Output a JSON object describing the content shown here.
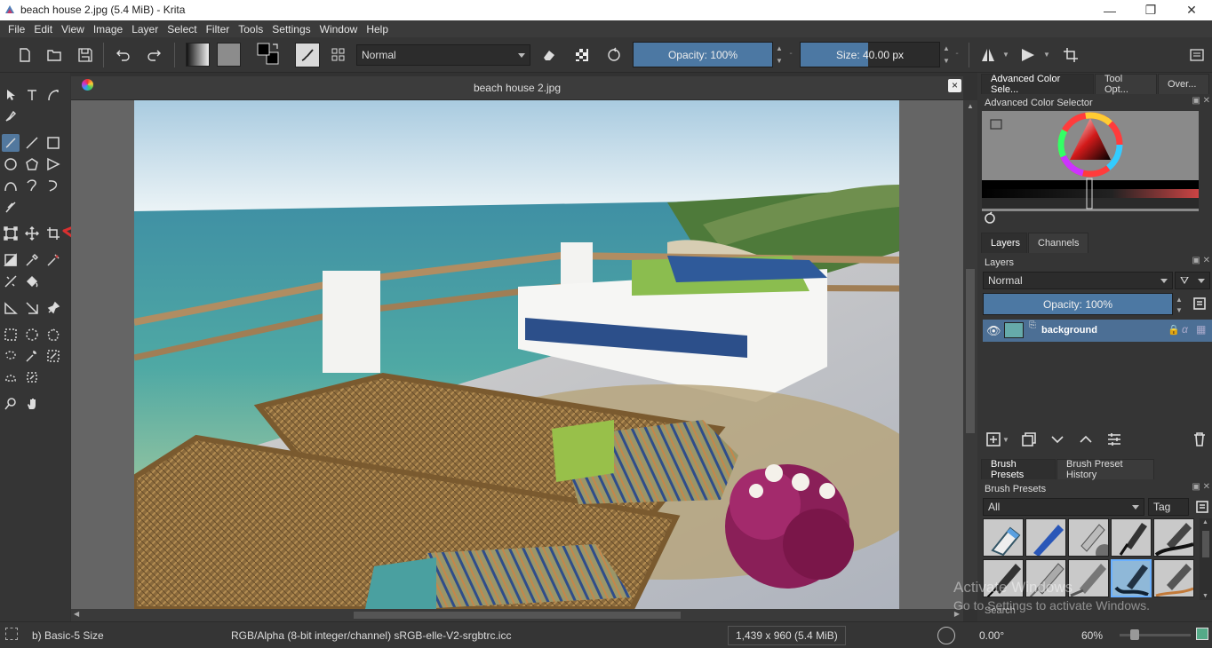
{
  "window": {
    "title": "beach house 2.jpg (5.4 MiB)  - Krita",
    "minimize_glyph": "—",
    "maximize_glyph": "❐",
    "close_glyph": "✕"
  },
  "menu": [
    "File",
    "Edit",
    "View",
    "Image",
    "Layer",
    "Select",
    "Filter",
    "Tools",
    "Settings",
    "Window",
    "Help"
  ],
  "toolbar": {
    "blend_mode": "Normal",
    "opacity_label": "Opacity: 100%",
    "opacity_value": 1.0,
    "size_label": "Size: 40.00 px",
    "size_fill_fraction": 0.49
  },
  "document": {
    "tab_title": "beach house 2.jpg",
    "close_glyph": "×"
  },
  "dockers": {
    "top_tabs": [
      "Advanced Color Sele...",
      "Tool Opt...",
      "Over..."
    ],
    "color_selector_title": "Advanced Color Selector",
    "layers_tabs": [
      "Layers",
      "Channels"
    ],
    "layers_title": "Layers",
    "layer_blend_mode": "Normal",
    "layer_opacity_label": "Opacity:  100%",
    "layers": [
      {
        "name": "background",
        "visible": true
      }
    ],
    "brush_tabs": [
      "Brush Presets",
      "Brush Preset History"
    ],
    "brush_presets_title": "Brush Presets",
    "brush_filter": "All",
    "tag_label": "Tag",
    "search_label": "Search"
  },
  "status": {
    "brush": "b) Basic-5 Size",
    "color_space": "RGB/Alpha (8-bit integer/channel)  sRGB-elle-V2-srgbtrc.icc",
    "image_size": "1,439 x 960 (5.4 MiB)",
    "rotation": "0.00°",
    "zoom": "60%"
  },
  "watermark": {
    "line1": "Activate Windows",
    "line2": "Go to Settings to activate Windows."
  },
  "colors": {
    "accent": "#4c78a3",
    "panel": "#353535",
    "canvas_bg": "#656565",
    "annotation_arrow": "#d93030"
  }
}
